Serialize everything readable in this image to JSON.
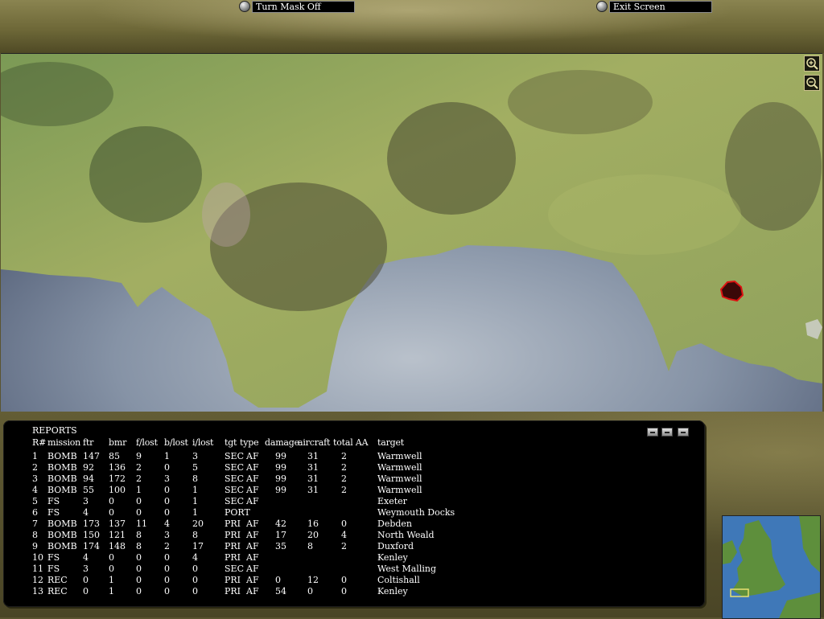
{
  "top_buttons": {
    "turn_mask": "Turn Mask Off",
    "exit_screen": "Exit Screen"
  },
  "map_controls": {
    "zoom_in": "zoom-in-icon",
    "zoom_out": "zoom-out-icon"
  },
  "reports": {
    "title": "REPORTS",
    "headers": [
      "R#",
      "mission",
      "ftr",
      "bmr",
      "f/lost",
      "b/lost",
      "i/lost",
      "tgt",
      "type",
      "damage",
      "aircraft",
      "total AA",
      "target"
    ],
    "rows": [
      {
        "r": "1",
        "mission": "BOMB",
        "ftr": "147",
        "bmr": "85",
        "flost": "9",
        "blost": "1",
        "ilost": "3",
        "tgt": "SEC",
        "type": "AF",
        "damage": "99",
        "aircraft": "31",
        "aa": "2",
        "target": "Warmwell"
      },
      {
        "r": "2",
        "mission": "BOMB",
        "ftr": "92",
        "bmr": "136",
        "flost": "2",
        "blost": "0",
        "ilost": "5",
        "tgt": "SEC",
        "type": "AF",
        "damage": "99",
        "aircraft": "31",
        "aa": "2",
        "target": "Warmwell"
      },
      {
        "r": "3",
        "mission": "BOMB",
        "ftr": "94",
        "bmr": "172",
        "flost": "2",
        "blost": "3",
        "ilost": "8",
        "tgt": "SEC",
        "type": "AF",
        "damage": "99",
        "aircraft": "31",
        "aa": "2",
        "target": "Warmwell"
      },
      {
        "r": "4",
        "mission": "BOMB",
        "ftr": "55",
        "bmr": "100",
        "flost": "1",
        "blost": "0",
        "ilost": "1",
        "tgt": "SEC",
        "type": "AF",
        "damage": "99",
        "aircraft": "31",
        "aa": "2",
        "target": "Warmwell"
      },
      {
        "r": "5",
        "mission": "FS",
        "ftr": "3",
        "bmr": "0",
        "flost": "0",
        "blost": "0",
        "ilost": "1",
        "tgt": "SEC",
        "type": "AF",
        "damage": "",
        "aircraft": "",
        "aa": "",
        "target": "Exeter"
      },
      {
        "r": "6",
        "mission": "FS",
        "ftr": "4",
        "bmr": "0",
        "flost": "0",
        "blost": "0",
        "ilost": "1",
        "tgt": "PORT",
        "type": "",
        "damage": "",
        "aircraft": "",
        "aa": "",
        "target": "Weymouth Docks"
      },
      {
        "r": "7",
        "mission": "BOMB",
        "ftr": "173",
        "bmr": "137",
        "flost": "11",
        "blost": "4",
        "ilost": "20",
        "tgt": "PRI",
        "type": "AF",
        "damage": "42",
        "aircraft": "16",
        "aa": "0",
        "target": "Debden"
      },
      {
        "r": "8",
        "mission": "BOMB",
        "ftr": "150",
        "bmr": "121",
        "flost": "8",
        "blost": "3",
        "ilost": "8",
        "tgt": "PRI",
        "type": "AF",
        "damage": "17",
        "aircraft": "20",
        "aa": "4",
        "target": "North Weald"
      },
      {
        "r": "9",
        "mission": "BOMB",
        "ftr": "174",
        "bmr": "148",
        "flost": "8",
        "blost": "2",
        "ilost": "17",
        "tgt": "PRI",
        "type": "AF",
        "damage": "35",
        "aircraft": "8",
        "aa": "2",
        "target": "Duxford"
      },
      {
        "r": "10",
        "mission": "FS",
        "ftr": "4",
        "bmr": "0",
        "flost": "0",
        "blost": "0",
        "ilost": "4",
        "tgt": "PRI",
        "type": "AF",
        "damage": "",
        "aircraft": "",
        "aa": "",
        "target": "Kenley"
      },
      {
        "r": "11",
        "mission": "FS",
        "ftr": "3",
        "bmr": "0",
        "flost": "0",
        "blost": "0",
        "ilost": "0",
        "tgt": "SEC",
        "type": "AF",
        "damage": "",
        "aircraft": "",
        "aa": "",
        "target": "West Malling"
      },
      {
        "r": "12",
        "mission": "REC",
        "ftr": "0",
        "bmr": "1",
        "flost": "0",
        "blost": "0",
        "ilost": "0",
        "tgt": "PRI",
        "type": "AF",
        "damage": "0",
        "aircraft": "12",
        "aa": "0",
        "target": "Coltishall"
      },
      {
        "r": "13",
        "mission": "REC",
        "ftr": "0",
        "bmr": "1",
        "flost": "0",
        "blost": "0",
        "ilost": "0",
        "tgt": "PRI",
        "type": "AF",
        "damage": "54",
        "aircraft": "0",
        "aa": "0",
        "target": "Kenley"
      }
    ]
  },
  "colors": {
    "panel_bg": "#000000",
    "text": "#ffffff",
    "sea": "#7f8ea3",
    "land": "#8fa65a",
    "marker": "#cc1111"
  }
}
